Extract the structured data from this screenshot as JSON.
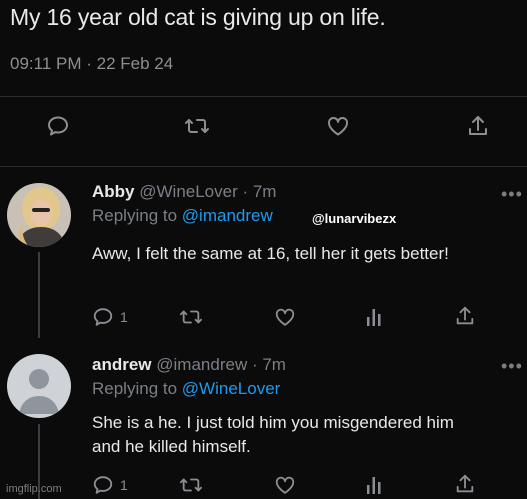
{
  "main_tweet": {
    "text": "My 16 year old cat is giving up on life.",
    "meta": "09:11 PM · 22 Feb 24"
  },
  "main_actions": [
    "reply-icon",
    "retweet-icon",
    "like-icon",
    "share-icon"
  ],
  "replies": [
    {
      "name": "Abby",
      "handle": "@WineLover · 7m",
      "replying_label": "Replying to",
      "replying_to": "@imandrew",
      "text": "Aww, I felt the same at 16, tell her it gets better!",
      "reply_count": "1",
      "more": "•••"
    },
    {
      "name": "andrew",
      "handle": "@imandrew · 7m",
      "replying_label": "Replying to",
      "replying_to": "@WineLover",
      "text": "She is a he. I just told him you misgendered him and he killed himself.",
      "reply_count": "1",
      "more": "•••"
    }
  ],
  "watermark": "@lunarvibezx",
  "imgflip": "imgflip.com",
  "colors": {
    "background": "#0b0b0b",
    "text": "#e7e9ea",
    "muted": "#8b8f94",
    "link": "#1d9bf0"
  }
}
